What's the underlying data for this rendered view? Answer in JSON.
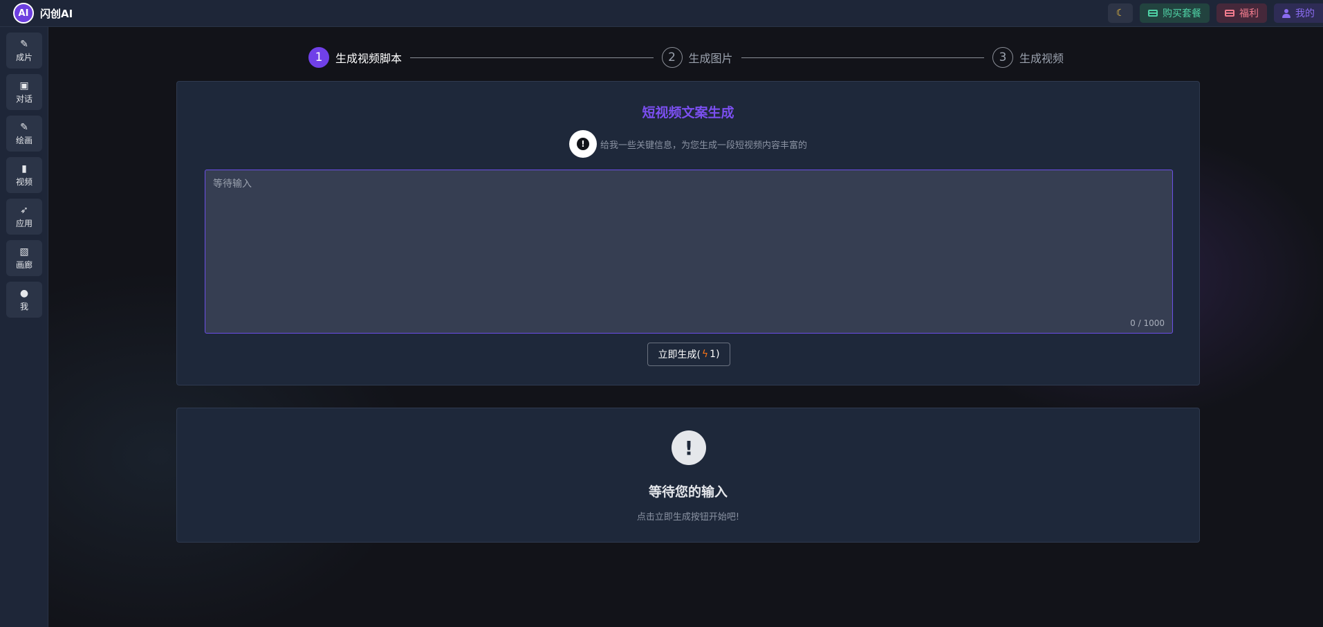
{
  "app": {
    "title": "闪创AI",
    "logo_text": "AI"
  },
  "header": {
    "theme_icon": "moon-icon",
    "buy_label": "购买套餐",
    "welfare_label": "福利",
    "mine_label": "我的"
  },
  "sidebar": {
    "items": [
      {
        "label": "成片",
        "icon": "magic-wand-icon"
      },
      {
        "label": "对话",
        "icon": "chat-icon"
      },
      {
        "label": "绘画",
        "icon": "magic-wand-icon"
      },
      {
        "label": "视频",
        "icon": "phone-icon"
      },
      {
        "label": "应用",
        "icon": "rocket-icon"
      },
      {
        "label": "画廊",
        "icon": "gallery-icon"
      },
      {
        "label": "我",
        "icon": "user-icon"
      }
    ]
  },
  "stepper": {
    "steps": [
      {
        "num": "1",
        "label": "生成视频脚本",
        "active": true
      },
      {
        "num": "2",
        "label": "生成图片",
        "active": false
      },
      {
        "num": "3",
        "label": "生成视频",
        "active": false
      }
    ]
  },
  "main": {
    "title": "短视频文案生成",
    "hint": "给我一些关键信息，为您生成一段短视频内容丰富的",
    "input_placeholder": "等待输入",
    "input_value": "",
    "counter": "0 / 1000",
    "generate_label": "立即生成(",
    "generate_cost": "1)",
    "generate_icon": "lightning-icon"
  },
  "result": {
    "title": "等待您的输入",
    "subtitle": "点击立即生成按钮开始吧!"
  },
  "colors": {
    "accent": "#7040e8",
    "background": "#121319",
    "panel": "#1e283a",
    "buy": "#4fd1a5",
    "welfare": "#f47c8e"
  }
}
